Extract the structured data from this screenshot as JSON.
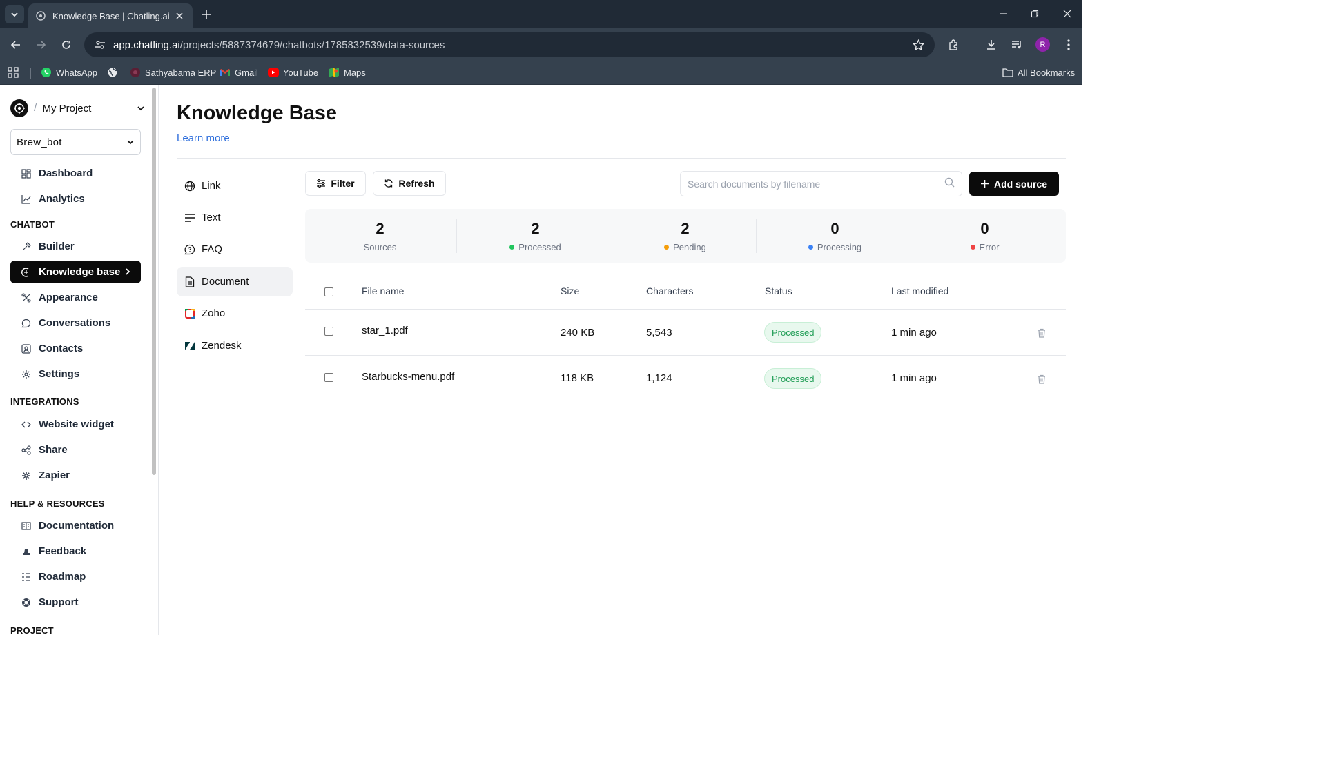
{
  "browser": {
    "tab_title": "Knowledge Base | Chatling.ai",
    "url_host": "app.chatling.ai",
    "url_path": "/projects/5887374679/chatbots/1785832539/data-sources",
    "profile_initial": "R",
    "bookmarks": [
      {
        "label": "WhatsApp",
        "icon": "whatsapp-icon"
      },
      {
        "label": "",
        "icon": "globe-icon"
      },
      {
        "label": "Sathyabama ERP",
        "icon": "sathyabama-icon"
      },
      {
        "label": "Gmail",
        "icon": "gmail-icon"
      },
      {
        "label": "YouTube",
        "icon": "youtube-icon"
      },
      {
        "label": "Maps",
        "icon": "maps-icon"
      }
    ],
    "all_bookmarks": "All Bookmarks"
  },
  "sidebar": {
    "project_name": "My Project",
    "bot_name": "Brew_bot",
    "top_items": [
      {
        "label": "Dashboard",
        "icon": "dashboard-icon"
      },
      {
        "label": "Analytics",
        "icon": "analytics-icon"
      }
    ],
    "section_chatbot": "CHATBOT",
    "chatbot_items": [
      {
        "label": "Builder",
        "icon": "builder-icon"
      },
      {
        "label": "Knowledge base",
        "icon": "knowledge-icon",
        "active": true
      },
      {
        "label": "Appearance",
        "icon": "appearance-icon"
      },
      {
        "label": "Conversations",
        "icon": "conversations-icon"
      },
      {
        "label": "Contacts",
        "icon": "contacts-icon"
      },
      {
        "label": "Settings",
        "icon": "settings-icon"
      }
    ],
    "section_integrations": "INTEGRATIONS",
    "integration_items": [
      {
        "label": "Website widget",
        "icon": "code-icon"
      },
      {
        "label": "Share",
        "icon": "share-icon"
      },
      {
        "label": "Zapier",
        "icon": "zapier-icon"
      }
    ],
    "section_help": "HELP & RESOURCES",
    "help_items": [
      {
        "label": "Documentation",
        "icon": "book-icon"
      },
      {
        "label": "Feedback",
        "icon": "feedback-icon"
      },
      {
        "label": "Roadmap",
        "icon": "roadmap-icon"
      },
      {
        "label": "Support",
        "icon": "support-icon"
      }
    ],
    "section_project": "PROJECT"
  },
  "main": {
    "title": "Knowledge Base",
    "learn_more": "Learn more",
    "source_types": [
      {
        "label": "Link",
        "icon": "globe-icon"
      },
      {
        "label": "Text",
        "icon": "text-icon"
      },
      {
        "label": "FAQ",
        "icon": "faq-icon"
      },
      {
        "label": "Document",
        "icon": "document-icon",
        "active": true
      },
      {
        "label": "Zoho",
        "icon": "zoho-icon"
      },
      {
        "label": "Zendesk",
        "icon": "zendesk-icon"
      }
    ],
    "filter_label": "Filter",
    "refresh_label": "Refresh",
    "search_placeholder": "Search documents by filename",
    "add_source_label": "Add source",
    "stats": [
      {
        "value": "2",
        "label": "Sources",
        "dot": null
      },
      {
        "value": "2",
        "label": "Processed",
        "dot": "#22c55e"
      },
      {
        "value": "2",
        "label": "Pending",
        "dot": "#f59e0b"
      },
      {
        "value": "0",
        "label": "Processing",
        "dot": "#3b82f6"
      },
      {
        "value": "0",
        "label": "Error",
        "dot": "#ef4444"
      }
    ],
    "table": {
      "headers": [
        "File name",
        "Size",
        "Characters",
        "Status",
        "Last modified"
      ],
      "rows": [
        {
          "file": "star_1.pdf",
          "size": "240 KB",
          "chars": "5,543",
          "status": "Processed",
          "modified": "1 min ago"
        },
        {
          "file": "Starbucks-menu.pdf",
          "size": "118 KB",
          "chars": "1,124",
          "status": "Processed",
          "modified": "1 min ago"
        }
      ]
    }
  }
}
